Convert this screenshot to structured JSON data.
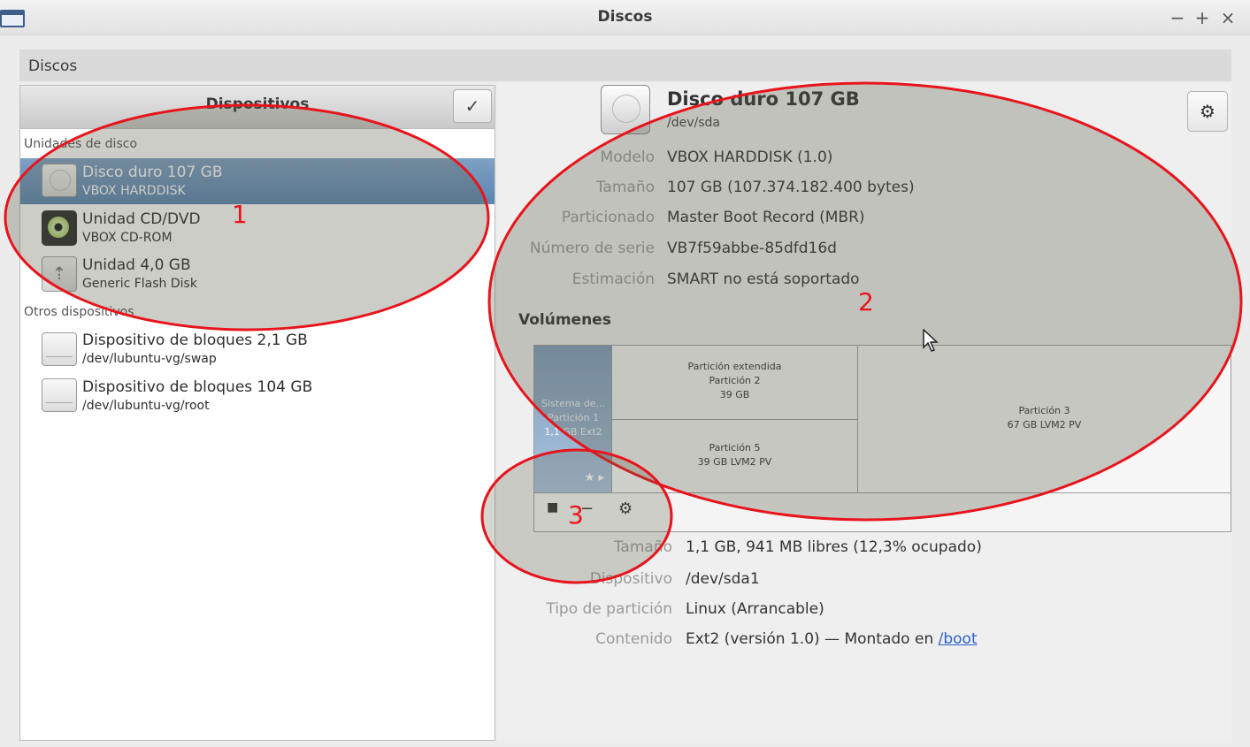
{
  "window": {
    "title": "Discos",
    "controls": [
      "−",
      "+",
      "×"
    ]
  },
  "subtitle": "Discos",
  "left": {
    "header": "Dispositivos",
    "select_icon": "check-icon",
    "sections": [
      {
        "label": "Unidades de disco",
        "items": [
          {
            "title": "Disco duro 107 GB",
            "subtitle": "VBOX HARDDISK",
            "icon": "hdd-icon",
            "selected": true
          },
          {
            "title": "Unidad CD/DVD",
            "subtitle": "VBOX CD-ROM",
            "icon": "cd-icon"
          },
          {
            "title": "Unidad 4,0 GB",
            "subtitle": "Generic Flash Disk",
            "icon": "usb-icon"
          }
        ]
      },
      {
        "label": "Otros dispositivos",
        "items": [
          {
            "title": "Dispositivo de bloques 2,1 GB",
            "subtitle": "/dev/lubuntu-vg/swap",
            "icon": "block-device-icon"
          },
          {
            "title": "Dispositivo de bloques 104 GB",
            "subtitle": "/dev/lubuntu-vg/root",
            "icon": "block-device-icon"
          }
        ]
      }
    ]
  },
  "disk": {
    "title": "Disco duro 107 GB",
    "path": "/dev/sda",
    "props": [
      {
        "label": "Modelo",
        "value": "VBOX HARDDISK (1.0)"
      },
      {
        "label": "Tamaño",
        "value": "107 GB (107.374.182.400 bytes)"
      },
      {
        "label": "Particionado",
        "value": "Master Boot Record (MBR)"
      },
      {
        "label": "Número de serie",
        "value": "VB7f59abbe-85dfd16d"
      },
      {
        "label": "Estimación",
        "value": "SMART no está soportado"
      }
    ]
  },
  "volumes": {
    "heading": "Volúmenes",
    "p1": {
      "line1": "Sistema de...",
      "line2": "Partición 1",
      "line3": "1,1 GB Ext2",
      "marks": "★ ▸"
    },
    "extended": {
      "line1": "Partición extendida",
      "line2": "Partición 2",
      "line3": "39 GB"
    },
    "p5": {
      "line1": "Partición 5",
      "line2": "39 GB LVM2 PV"
    },
    "p3": {
      "line1": "Partición 3",
      "line2": "67 GB LVM2 PV"
    },
    "toolbar": {
      "stop": "■",
      "minus": "−",
      "gear": "⚙"
    }
  },
  "volume_details": [
    {
      "label": "Tamaño",
      "value": "1,1 GB, 941 MB libres (12,3% ocupado)"
    },
    {
      "label": "Dispositivo",
      "value": "/dev/sda1"
    },
    {
      "label": "Tipo de partición",
      "value": "Linux (Arrancable)"
    },
    {
      "label": "Contenido",
      "value": "Ext2 (versión 1.0) — Montado en",
      "link": "/boot"
    }
  ],
  "annotations": [
    "1",
    "2",
    "3"
  ]
}
